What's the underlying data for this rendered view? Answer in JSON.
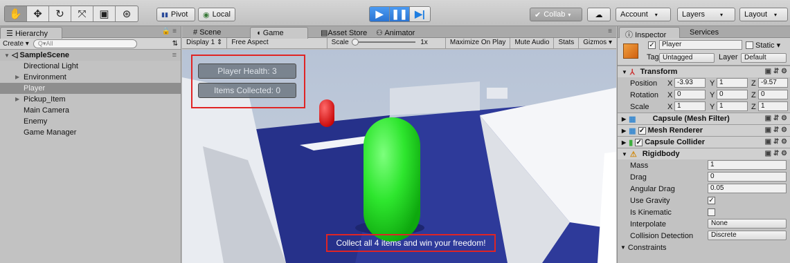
{
  "toolbar": {
    "tools": [
      "hand",
      "move",
      "rotate",
      "scale",
      "rect",
      "transform"
    ],
    "pivot": "Pivot",
    "local": "Local",
    "collab": "Collab",
    "account": "Account",
    "layers": "Layers",
    "layout": "Layout"
  },
  "hierarchy": {
    "tab": "Hierarchy",
    "create": "Create",
    "search_placeholder": "Q▾All",
    "scene": "SampleScene",
    "items": [
      {
        "label": "Directional Light",
        "expandable": false,
        "selected": false
      },
      {
        "label": "Environment",
        "expandable": true,
        "selected": false
      },
      {
        "label": "Player",
        "expandable": false,
        "selected": true
      },
      {
        "label": "Pickup_Item",
        "expandable": true,
        "selected": false
      },
      {
        "label": "Main Camera",
        "expandable": false,
        "selected": false
      },
      {
        "label": "Enemy",
        "expandable": false,
        "selected": false
      },
      {
        "label": "Game Manager",
        "expandable": false,
        "selected": false
      }
    ]
  },
  "center_tabs": {
    "scene": "Scene",
    "game": "Game",
    "asset_store": "Asset Store",
    "animator": "Animator"
  },
  "game_bar": {
    "display": "Display 1",
    "aspect": "Free Aspect",
    "scale_label": "Scale",
    "scale_value": "1x",
    "maximize": "Maximize On Play",
    "mute": "Mute Audio",
    "stats": "Stats",
    "gizmos": "Gizmos"
  },
  "hud": {
    "health": "Player Health: 3",
    "items": "Items Collected: 0",
    "message": "Collect all 4 items and win your freedom!"
  },
  "inspector": {
    "tab": "Inspector",
    "services_tab": "Services",
    "object_name": "Player",
    "static_label": "Static",
    "tag_label": "Tag",
    "tag_value": "Untagged",
    "layer_label": "Layer",
    "layer_value": "Default",
    "transform": {
      "title": "Transform",
      "position_label": "Position",
      "position": {
        "x": "-3.93",
        "y": "1",
        "z": "-9.57"
      },
      "rotation_label": "Rotation",
      "rotation": {
        "x": "0",
        "y": "0",
        "z": "0"
      },
      "scale_label": "Scale",
      "scale": {
        "x": "1",
        "y": "1",
        "z": "1"
      }
    },
    "components": {
      "mesh_filter": "Capsule (Mesh Filter)",
      "mesh_renderer": "Mesh Renderer",
      "collider": "Capsule Collider",
      "rigidbody": "Rigidbody"
    },
    "rigidbody": {
      "mass_label": "Mass",
      "mass": "1",
      "drag_label": "Drag",
      "drag": "0",
      "angular_drag_label": "Angular Drag",
      "angular_drag": "0.05",
      "use_gravity_label": "Use Gravity",
      "use_gravity": true,
      "is_kinematic_label": "Is Kinematic",
      "is_kinematic": false,
      "interpolate_label": "Interpolate",
      "interpolate": "None",
      "collision_label": "Collision Detection",
      "collision": "Discrete",
      "constraints_label": "Constraints"
    }
  },
  "colors": {
    "play_active": "#2a73d2",
    "highlight_red": "#e02424",
    "player_green": "#2ee62e",
    "floor_blue": "#2e3a9a"
  }
}
